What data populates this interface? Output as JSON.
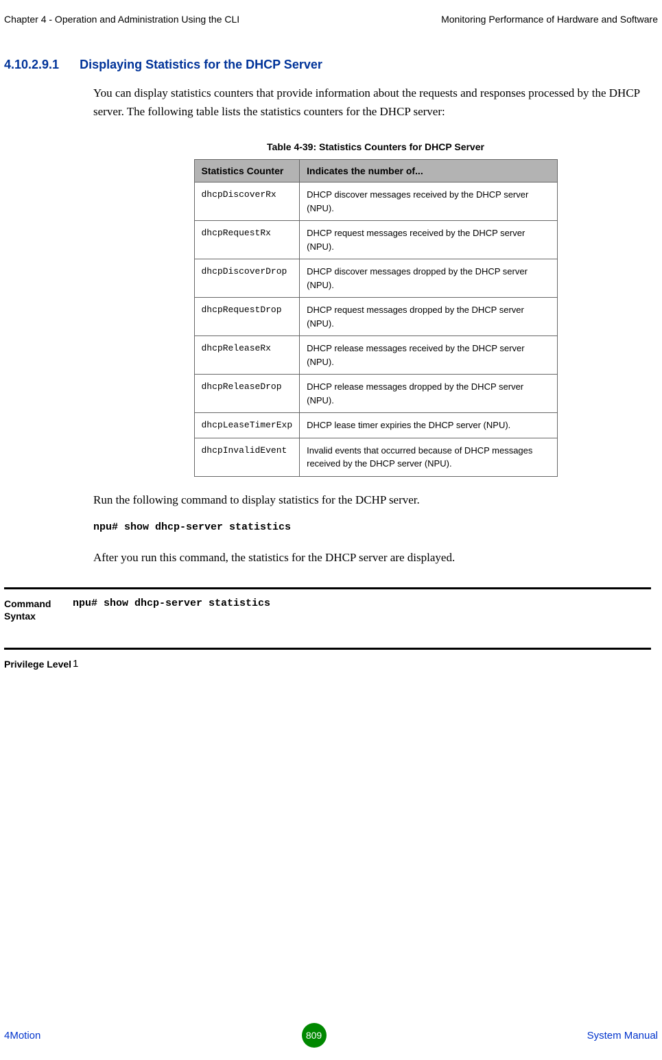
{
  "header": {
    "left": "Chapter 4 - Operation and Administration Using the CLI",
    "right": "Monitoring Performance of Hardware and Software"
  },
  "section": {
    "number": "4.10.2.9.1",
    "title": "Displaying Statistics for the DHCP Server",
    "intro": "You can display statistics counters that provide information about the requests and responses processed by the DHCP server. The following table lists the statistics counters for the DHCP server:"
  },
  "table": {
    "caption": "Table 4-39: Statistics Counters for DHCP Server",
    "headers": {
      "col1": "Statistics Counter",
      "col2": "Indicates the number of..."
    },
    "rows": [
      {
        "counter": "dhcpDiscoverRx",
        "desc": "DHCP discover messages received  by the DHCP server (NPU)."
      },
      {
        "counter": "dhcpRequestRx",
        "desc": "DHCP request messages received  by the DHCP server (NPU)."
      },
      {
        "counter": "dhcpDiscoverDrop",
        "desc": "DHCP discover messages dropped  by the DHCP server (NPU)."
      },
      {
        "counter": "dhcpRequestDrop",
        "desc": "DHCP request messages dropped  by the DHCP server (NPU)."
      },
      {
        "counter": "dhcpReleaseRx",
        "desc": "DHCP release messages received  by the DHCP server (NPU)."
      },
      {
        "counter": "dhcpReleaseDrop",
        "desc": "DHCP release messages dropped  by the DHCP server (NPU)."
      },
      {
        "counter": "dhcpLeaseTimerExp",
        "desc": "DHCP lease timer expiries the DHCP server (NPU)."
      },
      {
        "counter": "dhcpInvalidEvent",
        "desc": "Invalid events that occurred because of DHCP messages received by the DHCP server (NPU)."
      }
    ]
  },
  "post_table": {
    "para1": "Run the following command to display statistics for the DCHP server.",
    "command": "npu# show dhcp-server statistics",
    "para2": "After you run this command, the statistics for the DHCP server are displayed."
  },
  "command_syntax": {
    "label": "Command Syntax",
    "value": "npu# show dhcp-server statistics"
  },
  "privilege": {
    "label": "Privilege Level",
    "value": "1"
  },
  "footer": {
    "left": "4Motion",
    "page": "809",
    "right": "System Manual"
  }
}
